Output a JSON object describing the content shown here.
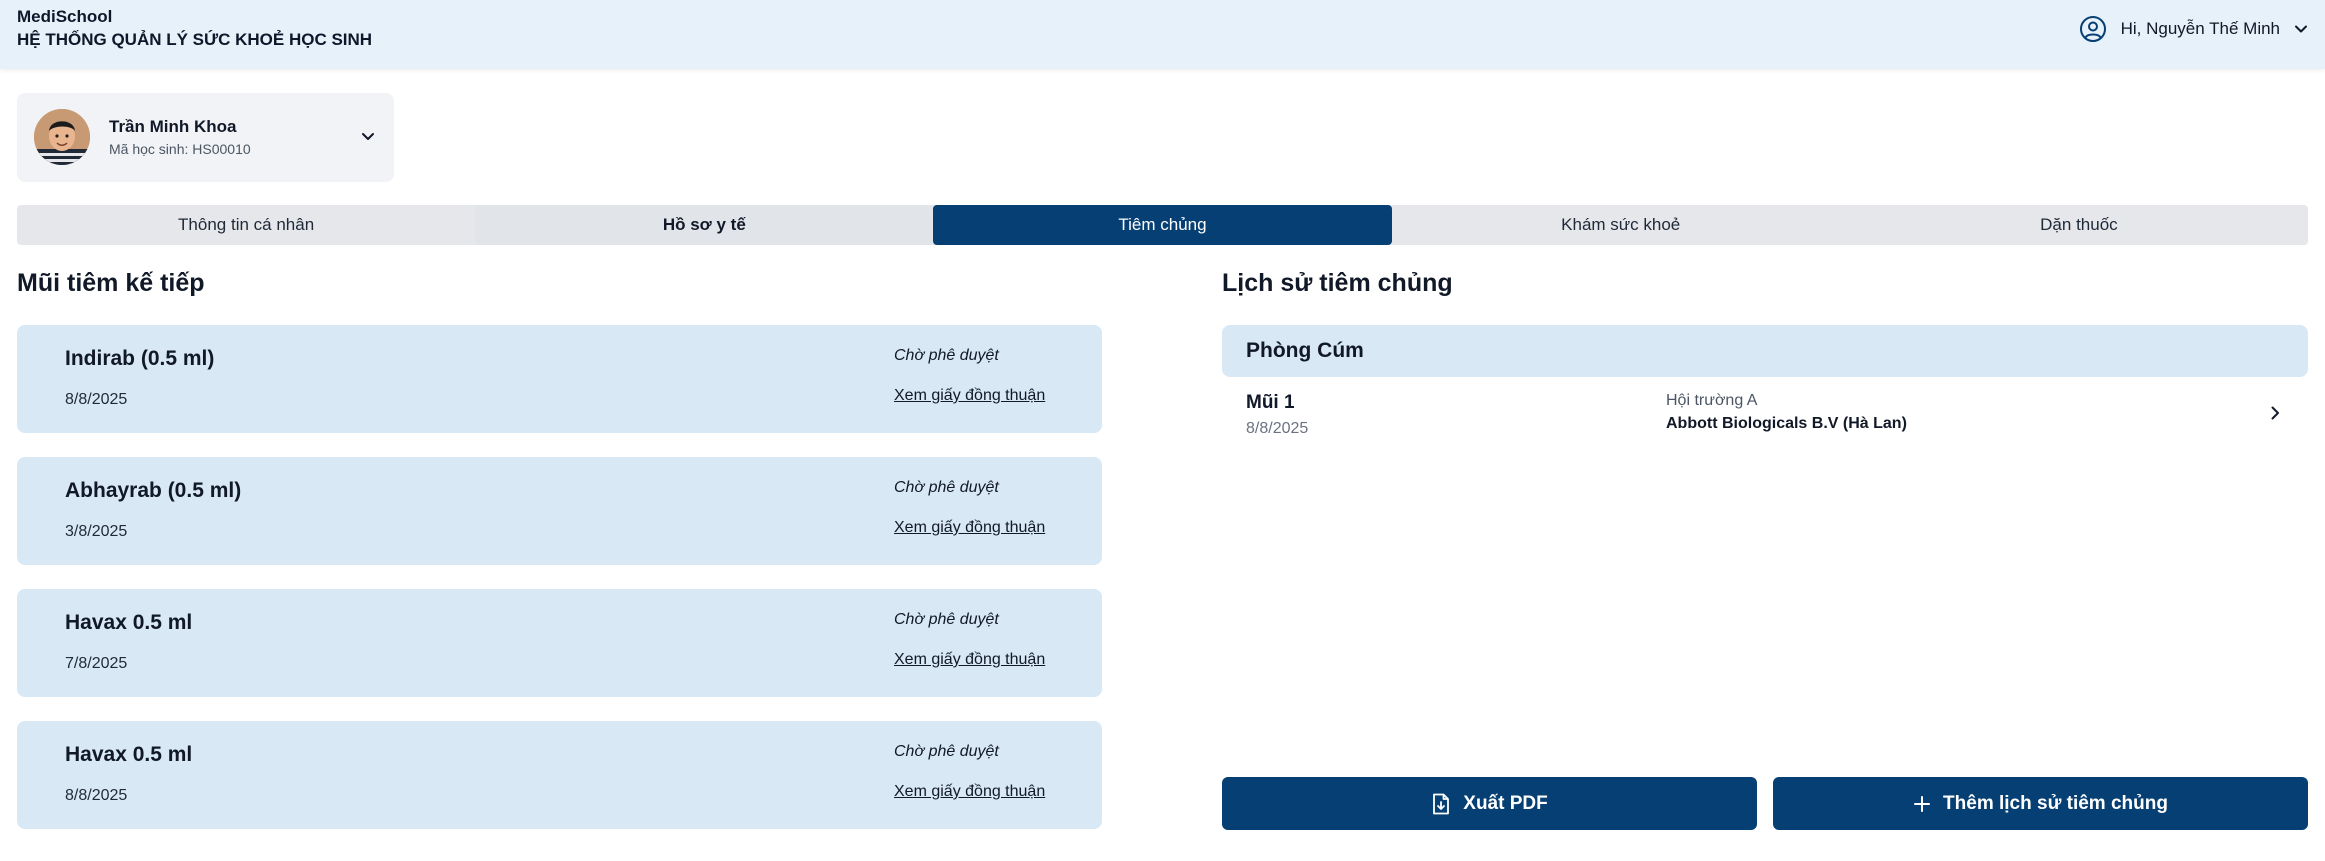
{
  "header": {
    "brand_name": "MediSchool",
    "brand_subtitle": "HỆ THỐNG QUẢN LÝ SỨC KHOẺ HỌC SINH",
    "greeting": "Hi, Nguyễn Thế Minh",
    "user_icon": "user-circle-icon",
    "dropdown_icon": "chevron-down-icon"
  },
  "student": {
    "name": "Trần Minh Khoa",
    "code": "Mã học sinh: HS00010"
  },
  "tabs": [
    {
      "label": "Thông tin cá nhân"
    },
    {
      "label": "Hồ sơ y tế"
    },
    {
      "label": "Tiêm chủng"
    },
    {
      "label": "Khám sức khoẻ"
    },
    {
      "label": "Dặn thuốc"
    }
  ],
  "upcoming": {
    "title": "Mũi tiêm kế tiếp",
    "items": [
      {
        "name": "Indirab (0.5 ml)",
        "date": "8/8/2025",
        "status": "Chờ phê duyệt",
        "link": "Xem giấy đồng thuận"
      },
      {
        "name": "Abhayrab (0.5 ml)",
        "date": "3/8/2025",
        "status": "Chờ phê duyệt",
        "link": "Xem giấy đồng thuận"
      },
      {
        "name": "Havax 0.5 ml",
        "date": "7/8/2025",
        "status": "Chờ phê duyệt",
        "link": "Xem giấy đồng thuận"
      },
      {
        "name": "Havax 0.5 ml",
        "date": "8/8/2025",
        "status": "Chờ phê duyệt",
        "link": "Xem giấy đồng thuận"
      }
    ]
  },
  "history": {
    "title": "Lịch sử tiêm chủng",
    "groups": [
      {
        "name": "Phòng Cúm",
        "doses": [
          {
            "dose": "Mũi 1",
            "date": "8/8/2025",
            "place": "Hội trường A",
            "manufacturer": "Abbott Biologicals B.V (Hà Lan)"
          }
        ]
      }
    ]
  },
  "actions": {
    "export_pdf": "Xuất PDF",
    "add_history": "Thêm lịch sử tiêm chủng"
  },
  "colors": {
    "primary": "#063f73",
    "card_bg": "#d9e8f5",
    "header_bg": "#e6f1fa"
  }
}
